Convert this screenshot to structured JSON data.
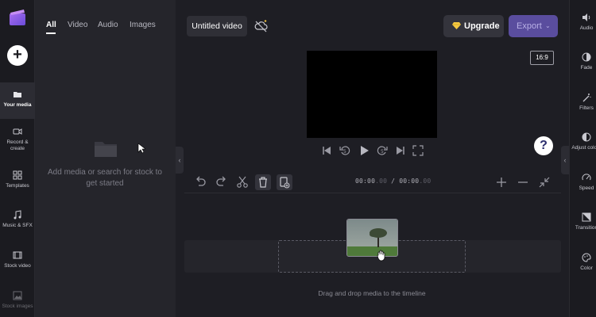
{
  "left_nav": {
    "items": [
      {
        "label": "Your media",
        "icon": "folder-icon",
        "active": true
      },
      {
        "label": "Record & create",
        "icon": "camera-icon"
      },
      {
        "label": "Templates",
        "icon": "templates-icon"
      },
      {
        "label": "Music & SFX",
        "icon": "music-icon"
      },
      {
        "label": "Stock video",
        "icon": "film-icon"
      },
      {
        "label": "Stock images",
        "icon": "image-icon"
      }
    ],
    "add_button": "+"
  },
  "media_panel": {
    "tabs": [
      "All",
      "Video",
      "Audio",
      "Images"
    ],
    "active_tab": "All",
    "empty_message": "Add media or search for stock to get started"
  },
  "header": {
    "project_title": "Untitled video",
    "upgrade_label": "Upgrade",
    "export_label": "Export"
  },
  "preview": {
    "aspect_ratio": "16:9",
    "help_label": "?"
  },
  "timeline": {
    "current_time": "00:00",
    "current_frac": ".00",
    "separator": " / ",
    "total_time": "00:00",
    "total_frac": ".00",
    "drop_message": "Drag and drop media to the timeline"
  },
  "right_panel": {
    "items": [
      {
        "label": "Audio",
        "icon": "speaker-icon"
      },
      {
        "label": "Fade",
        "icon": "fade-icon"
      },
      {
        "label": "Filters",
        "icon": "magic-wand-icon"
      },
      {
        "label": "Adjust colors",
        "icon": "adjust-icon"
      },
      {
        "label": "Speed",
        "icon": "speedometer-icon"
      },
      {
        "label": "Transition",
        "icon": "transition-icon"
      },
      {
        "label": "Color",
        "icon": "palette-icon"
      }
    ]
  },
  "colors": {
    "accent": "#5a4d9e",
    "background": "#1e1e24",
    "panel": "#25252b",
    "gem": "#f5c842"
  }
}
